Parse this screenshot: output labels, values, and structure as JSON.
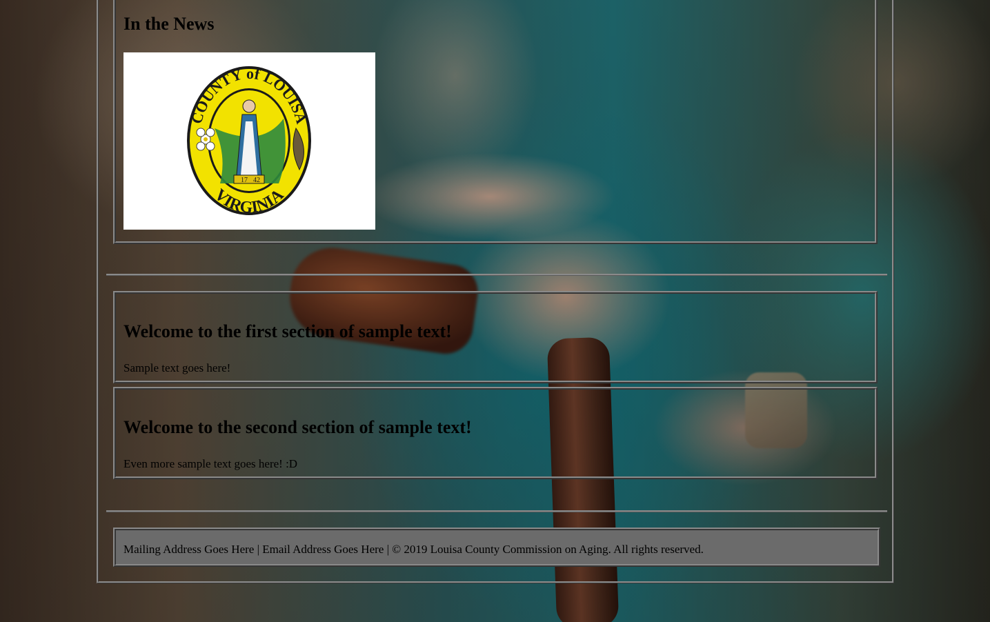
{
  "news": {
    "title": "In the News",
    "seal": {
      "top_text": "COUNTY of LOUISA",
      "bottom_text": "VIRGINIA",
      "numbers_left": "17",
      "numbers_right": "42",
      "colors": {
        "ring": "#f2e200",
        "outline": "#1a1a1a",
        "green": "#2e8b3e",
        "figure": "#2e6fa0"
      }
    }
  },
  "sections": [
    {
      "heading": "Welcome to the first section of sample text!",
      "text": "Sample text goes here!"
    },
    {
      "heading": "Welcome to the second section of sample text!",
      "text": "Even more sample text goes here! :D"
    }
  ],
  "footer": {
    "mailing": "Mailing Address Goes Here",
    "sep1": " | ",
    "email": "Email Address Goes Here",
    "sep2": " | ",
    "copyright": "© 2019 Louisa County Commission on Aging. All rights reserved."
  },
  "colors": {
    "panel_border": "#8a8a8a",
    "footer_bg": "#6b6b6b"
  }
}
